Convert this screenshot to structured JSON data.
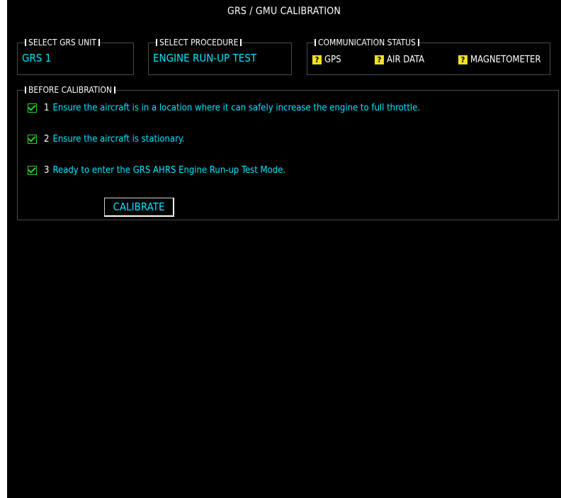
{
  "title": "GRS / GMU CALIBRATION",
  "grs_unit": {
    "label": "SELECT GRS UNIT",
    "value": "GRS 1"
  },
  "procedure": {
    "label": "SELECT PROCEDURE",
    "value": "ENGINE RUN-UP TEST"
  },
  "comm_status": {
    "label": "COMMUNICATION STATUS",
    "items": [
      {
        "label": "GPS",
        "status_icon": "question-icon"
      },
      {
        "label": "AIR DATA",
        "status_icon": "question-icon"
      },
      {
        "label": "MAGNETOMETER",
        "status_icon": "question-icon"
      }
    ]
  },
  "before_calibration": {
    "label": "BEFORE CALIBRATION",
    "steps": [
      {
        "num": "1",
        "text": "Ensure the aircraft is in a location where it can safely increase the engine to full throttle.",
        "checked": true
      },
      {
        "num": "2",
        "text": "Ensure the aircraft is stationary.",
        "checked": true
      },
      {
        "num": "3",
        "text": "Ready to enter the GRS AHRS Engine Run-up Test Mode.",
        "checked": true
      }
    ],
    "button_label": "CALIBRATE"
  },
  "colors": {
    "background": "#000000",
    "value_cyan": "#00e6ff",
    "check_green": "#2bd12b",
    "status_yellow": "#f0e020"
  }
}
